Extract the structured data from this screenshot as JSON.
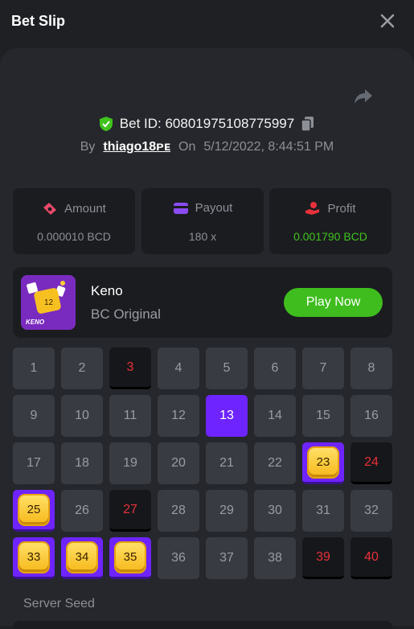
{
  "header": {
    "title": "Bet Slip"
  },
  "bet": {
    "id_text": "Bet ID: 60801975108775997",
    "by_label": "By",
    "username": "thiago18ᴘᴇ",
    "on_label": "On",
    "datetime": "5/12/2022, 8:44:51 PM"
  },
  "stats": {
    "amount": {
      "label": "Amount",
      "value": "0.000010 BCD"
    },
    "payout": {
      "label": "Payout",
      "value": "180 x"
    },
    "profit": {
      "label": "Profit",
      "value": "0.001790 BCD"
    }
  },
  "game": {
    "name": "Keno",
    "subtitle": "BC Original",
    "play_label": "Play Now",
    "thumb_label": "KENO",
    "thumb_number": "12"
  },
  "keno": {
    "numbers": [
      "1",
      "2",
      "3",
      "4",
      "5",
      "6",
      "7",
      "8",
      "9",
      "10",
      "11",
      "12",
      "13",
      "14",
      "15",
      "16",
      "17",
      "18",
      "19",
      "20",
      "21",
      "22",
      "23",
      "24",
      "25",
      "26",
      "27",
      "28",
      "29",
      "30",
      "31",
      "32",
      "33",
      "34",
      "35",
      "36",
      "37",
      "38",
      "39",
      "40"
    ],
    "hits": [
      23,
      25,
      33,
      34,
      35
    ],
    "misses": [
      3,
      24,
      27,
      39,
      40
    ],
    "drawn": [
      13
    ]
  },
  "seed": {
    "label": "Server Seed"
  },
  "colors": {
    "accent_green": "#3fbd1e",
    "accent_purple": "#6e24ff",
    "miss_red": "#e8313a"
  }
}
